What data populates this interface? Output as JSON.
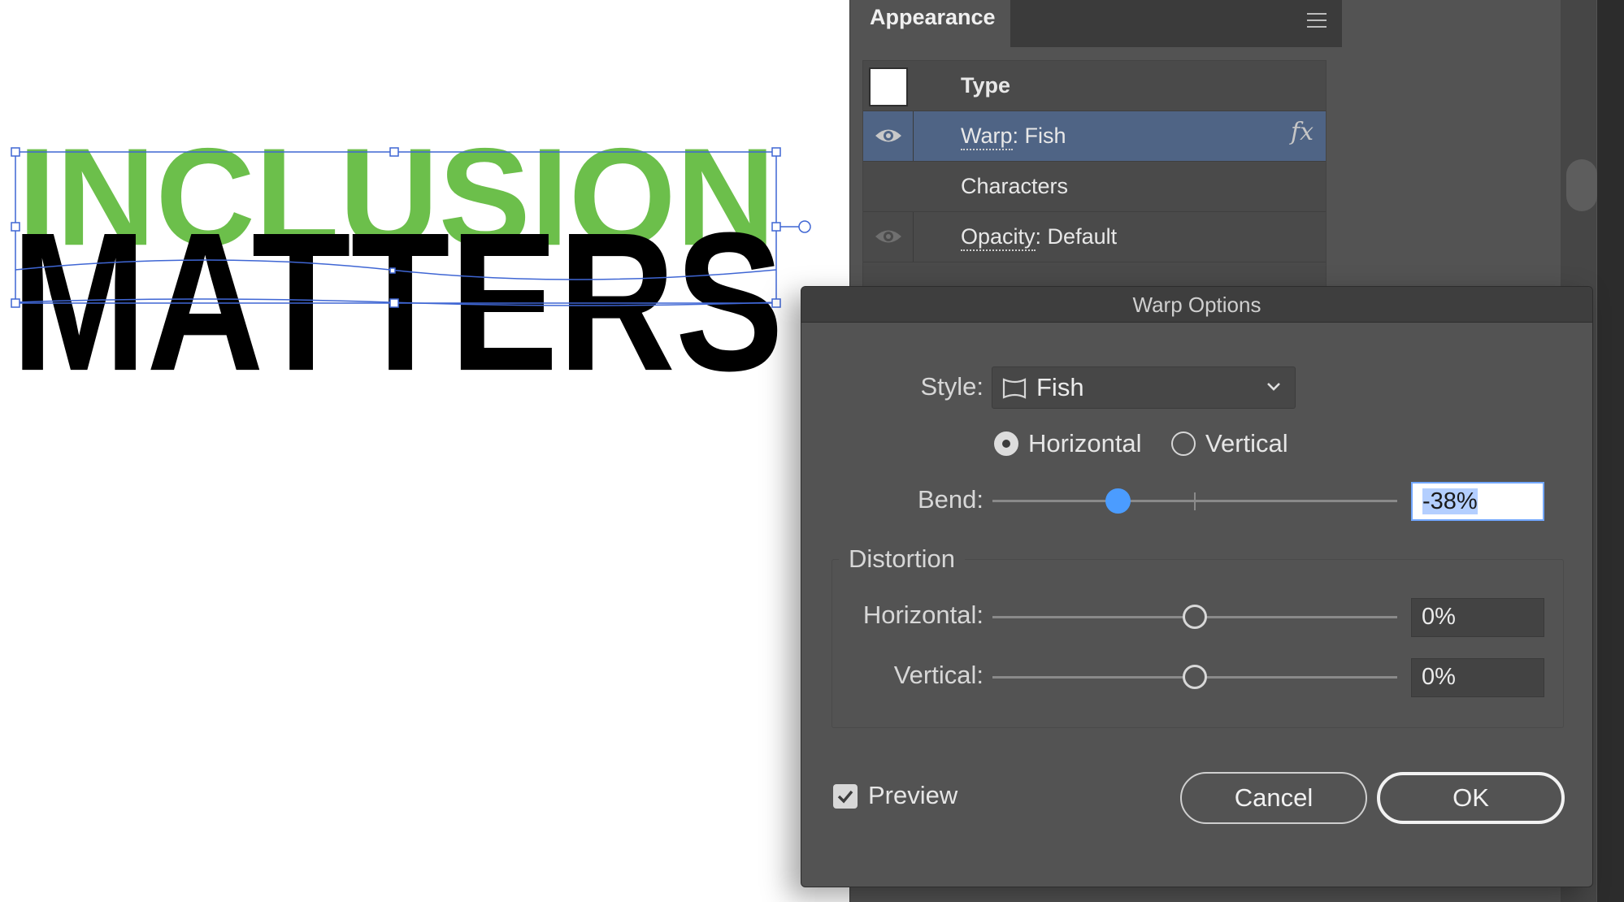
{
  "canvas": {
    "artwork_line1": "INCLUSION",
    "artwork_line2": "MATTERS",
    "line1_color": "#6cbf4b",
    "line2_color": "#000000",
    "selection_color": "#3f66d4"
  },
  "appearance_panel": {
    "tab_label": "Appearance",
    "rows": [
      {
        "label": "Type"
      },
      {
        "label_underlined": "Warp",
        "label_rest": ": Fish",
        "selected": true
      },
      {
        "label": "Characters"
      },
      {
        "label_underlined": "Opacity",
        "label_rest": ": Default"
      }
    ],
    "fx_label": "fx",
    "selected_color": "#4f6485"
  },
  "warp_dialog": {
    "title": "Warp Options",
    "style_label": "Style:",
    "style_value": "Fish",
    "orientation": {
      "horizontal_label": "Horizontal",
      "vertical_label": "Vertical",
      "selected": "Horizontal"
    },
    "bend": {
      "label": "Bend:",
      "value_text": "-38%",
      "value": -38,
      "min": -100,
      "max": 100
    },
    "distortion": {
      "title": "Distortion",
      "horizontal": {
        "label": "Horizontal:",
        "value_text": "0%",
        "value": 0,
        "min": -100,
        "max": 100
      },
      "vertical": {
        "label": "Vertical:",
        "value_text": "0%",
        "value": 0,
        "min": -100,
        "max": 100
      }
    },
    "preview": {
      "label": "Preview",
      "checked": true
    },
    "cancel_label": "Cancel",
    "ok_label": "OK",
    "accent_color": "#4b9cff"
  }
}
